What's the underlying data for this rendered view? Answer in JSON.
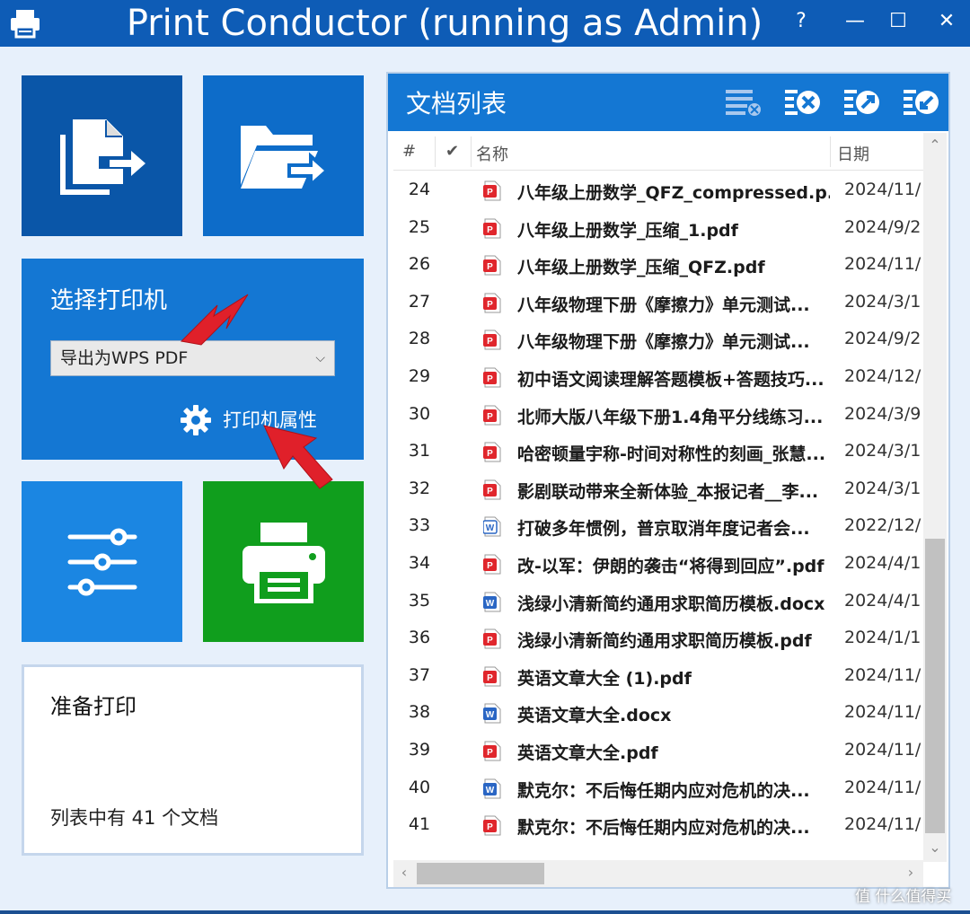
{
  "window": {
    "title": "Print Conductor (running as Admin)",
    "help_label": "?",
    "minimize_label": "—",
    "maximize_label": "☐",
    "close_label": "✕"
  },
  "printer_panel": {
    "heading": "选择打印机",
    "selected_printer": "导出为WPS PDF",
    "properties_label": "打印机属性"
  },
  "status": {
    "title": "准备打印",
    "count_text": "列表中有 41 个文档"
  },
  "doc_list": {
    "title": "文档列表",
    "columns": {
      "num": "#",
      "check": "✔",
      "name": "名称",
      "date": "日期"
    },
    "rows": [
      {
        "num": "24",
        "type": "pdf",
        "name": "八年级上册数学_QFZ_compressed.p...",
        "date": "2024/11/"
      },
      {
        "num": "25",
        "type": "pdf",
        "name": "八年级上册数学_压缩_1.pdf",
        "date": "2024/9/2"
      },
      {
        "num": "26",
        "type": "pdf",
        "name": "八年级上册数学_压缩_QFZ.pdf",
        "date": "2024/11/"
      },
      {
        "num": "27",
        "type": "pdf",
        "name": "八年级物理下册《摩擦力》单元测试...",
        "date": "2024/3/1"
      },
      {
        "num": "28",
        "type": "pdf",
        "name": "八年级物理下册《摩擦力》单元测试...",
        "date": "2024/9/2"
      },
      {
        "num": "29",
        "type": "pdf",
        "name": "初中语文阅读理解答题模板+答题技巧...",
        "date": "2024/12/"
      },
      {
        "num": "30",
        "type": "pdf",
        "name": "北师大版八年级下册1.4角平分线练习...",
        "date": "2024/3/9"
      },
      {
        "num": "31",
        "type": "pdf",
        "name": "哈密顿量宇称-时间对称性的刻画_张慧...",
        "date": "2024/3/1"
      },
      {
        "num": "32",
        "type": "pdf",
        "name": "影剧联动带来全新体验_本报记者__李...",
        "date": "2024/3/1"
      },
      {
        "num": "33",
        "type": "docx-outline",
        "name": "打破多年惯例，普京取消年度记者会...",
        "date": "2022/12/"
      },
      {
        "num": "34",
        "type": "pdf",
        "name": "改-以军：伊朗的袭击“将得到回应”.pdf",
        "date": "2024/4/1"
      },
      {
        "num": "35",
        "type": "docx",
        "name": "浅绿小清新简约通用求职简历模板.docx",
        "date": "2024/4/1"
      },
      {
        "num": "36",
        "type": "pdf",
        "name": "浅绿小清新简约通用求职简历模板.pdf",
        "date": "2024/1/1"
      },
      {
        "num": "37",
        "type": "pdf",
        "name": "英语文章大全 (1).pdf",
        "date": "2024/11/"
      },
      {
        "num": "38",
        "type": "docx",
        "name": "英语文章大全.docx",
        "date": "2024/11/"
      },
      {
        "num": "39",
        "type": "pdf",
        "name": "英语文章大全.pdf",
        "date": "2024/11/"
      },
      {
        "num": "40",
        "type": "docx",
        "name": "默克尔：不后悔任期内应对危机的决...",
        "date": "2024/11/"
      },
      {
        "num": "41",
        "type": "pdf",
        "name": "默克尔：不后悔任期内应对危机的决...",
        "date": "2024/11/"
      }
    ]
  },
  "watermark": "值 什么值得买",
  "colors": {
    "titlebar": "#0e5cb6",
    "tile_dark_blue": "#0a56a8",
    "tile_blue": "#1477d3",
    "tile_green": "#109e1d",
    "pdf_red": "#e0262c",
    "word_blue": "#2a66c4",
    "annotation_arrow": "#e0202a"
  },
  "icons": {
    "app": "printer-icon",
    "add_files": "add-files-icon",
    "add_folder": "add-folder-icon",
    "settings": "sliders-icon",
    "print": "print-icon",
    "properties": "gear-icon"
  }
}
